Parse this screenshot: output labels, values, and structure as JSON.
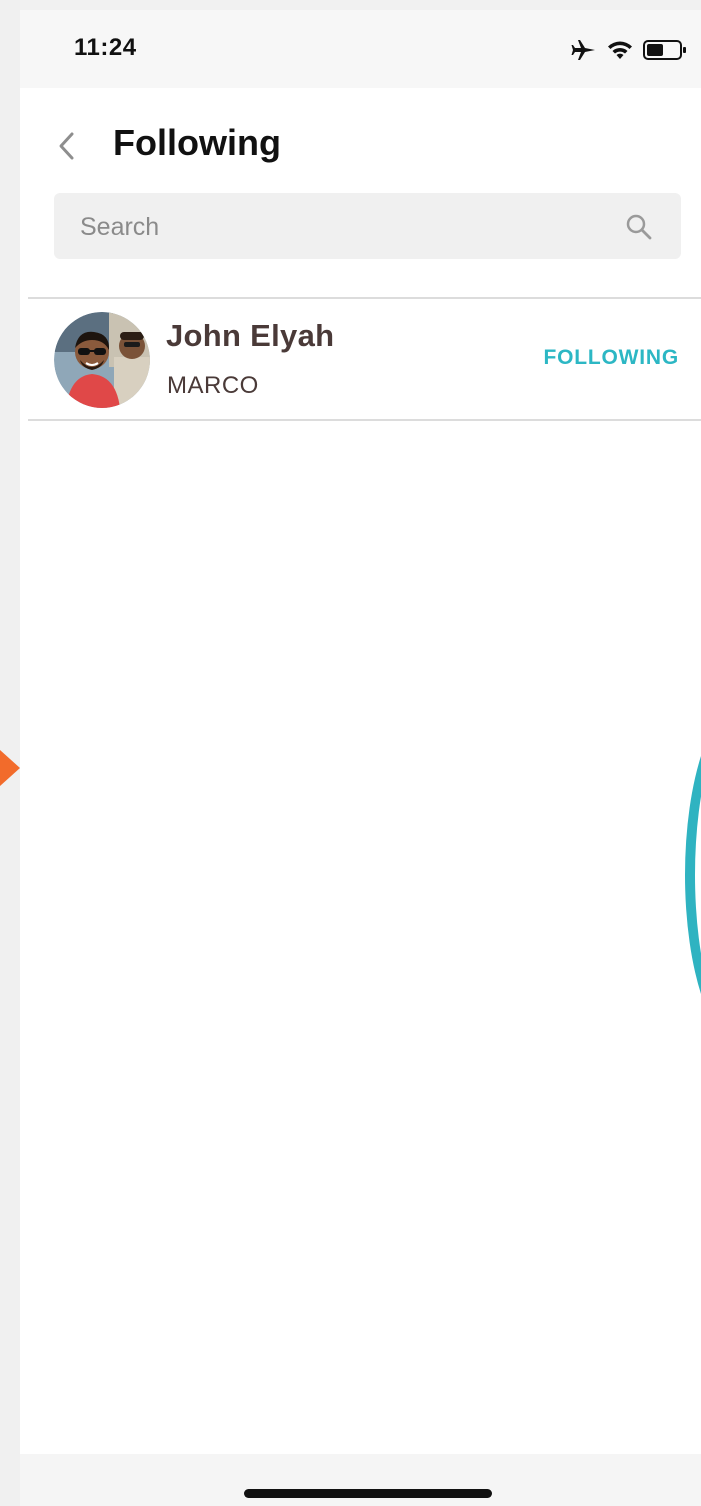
{
  "status_bar": {
    "time": "11:24",
    "icons": [
      "airplane-icon",
      "wifi-icon",
      "battery-icon"
    ]
  },
  "header": {
    "title": "Following",
    "back_icon": "chevron-left-icon"
  },
  "search": {
    "placeholder": "Search",
    "value": "",
    "icon": "search-icon"
  },
  "list": {
    "items": [
      {
        "name": "John Elyah",
        "handle": "MARCO",
        "action_label": "FOLLOWING",
        "avatar": "avatar-photo"
      }
    ]
  },
  "colors": {
    "accent": "#2cb7c4",
    "name_text": "#4a3a38",
    "orange_marker": "#f26b2b"
  }
}
